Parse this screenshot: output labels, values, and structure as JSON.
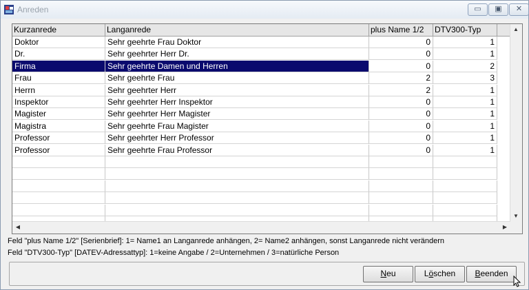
{
  "window": {
    "title": "Anreden"
  },
  "titlebar_buttons": {
    "minimize": "▭",
    "restore": "▣",
    "close": "✕"
  },
  "table": {
    "columns": [
      "Kurzanrede",
      "Langanrede",
      "plus Name 1/2",
      "DTV300-Typ"
    ],
    "selected_index": 2,
    "rows": [
      [
        "Doktor",
        "Sehr geehrte Frau Doktor",
        "0",
        "1"
      ],
      [
        "Dr.",
        "Sehr geehrter Herr Dr.",
        "0",
        "1"
      ],
      [
        "Firma",
        "Sehr geehrte Damen und Herren",
        "0",
        "2"
      ],
      [
        "Frau",
        "Sehr geehrte Frau",
        "2",
        "3"
      ],
      [
        "Herrn",
        "Sehr geehrter Herr",
        "2",
        "1"
      ],
      [
        "Inspektor",
        "Sehr geehrter Herr Inspektor",
        "0",
        "1"
      ],
      [
        "Magister",
        "Sehr geehrter Herr Magister",
        "0",
        "1"
      ],
      [
        "Magistra",
        "Sehr geehrte Frau Magister",
        "0",
        "1"
      ],
      [
        "Professor",
        "Sehr geehrter Herr Professor",
        "0",
        "1"
      ],
      [
        "Professor",
        "Sehr geehrte Frau Professor",
        "0",
        "1"
      ]
    ],
    "empty_rows": 6
  },
  "notes": {
    "line1": "Feld \"plus Name 1/2\" [Serienbrief]: 1= Name1 an Langanrede anhängen, 2= Name2 anhängen, sonst Langanrede nicht verändern",
    "line2": "Feld \"DTV300-Typ\" [DATEV-Adressattyp]: 1=keine Angabe / 2=Unternehmen / 3=natürliche Person"
  },
  "buttons": {
    "new": {
      "label_underlined": "N",
      "label_rest": "eu"
    },
    "delete": {
      "label_prefix": "L",
      "label_underlined": "ö",
      "label_rest": "schen"
    },
    "exit": {
      "label_underlined": "B",
      "label_rest": "eenden"
    }
  },
  "colors": {
    "selection": "#0a0a6e",
    "selection_text": "#ffffff"
  }
}
